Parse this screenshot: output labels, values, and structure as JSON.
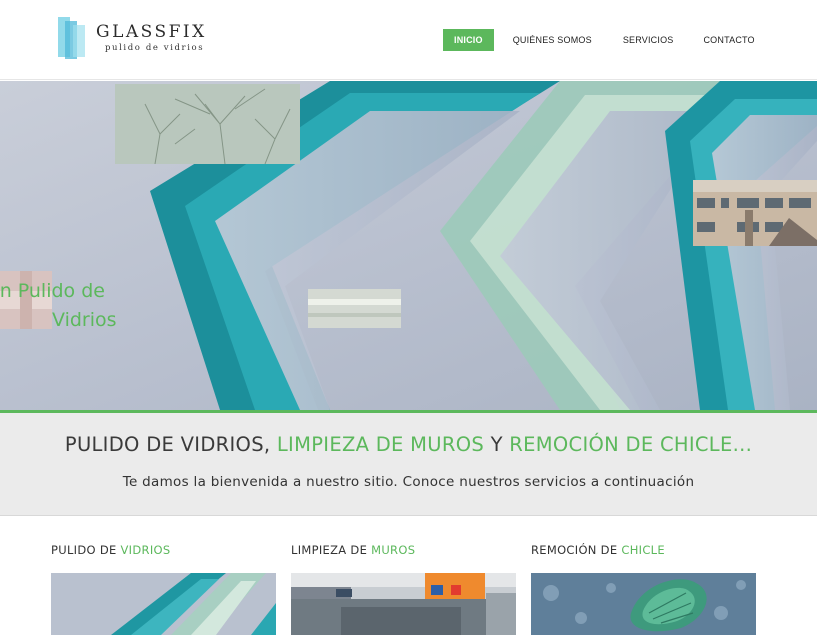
{
  "header": {
    "logo": {
      "name": "GLASSFIX",
      "tagline": "pulido de vidrios"
    },
    "nav": [
      {
        "label": "INICIO",
        "active": true
      },
      {
        "label": "QUIÉNES SOMOS",
        "active": false
      },
      {
        "label": "SERVICIOS",
        "active": false
      },
      {
        "label": "CONTACTO",
        "active": false
      }
    ]
  },
  "hero": {
    "caption_line1": "en Pulido de",
    "caption_line2": "Vidrios"
  },
  "welcome": {
    "title_part1": "PULIDO DE VIDRIOS,",
    "title_part2": "LIMPIEZA DE MUROS",
    "title_part3": "Y",
    "title_part4": "REMOCIÓN DE CHICLE...",
    "subtitle": "Te damos la bienvenida a nuestro sitio. Conoce nuestros servicios a continuación"
  },
  "services": [
    {
      "title_dark": "PULIDO DE",
      "title_green": "VIDRIOS"
    },
    {
      "title_dark": "LIMPIEZA DE",
      "title_green": "MUROS"
    },
    {
      "title_dark": "REMOCIÓN DE",
      "title_green": "CHICLE"
    }
  ],
  "colors": {
    "accent": "#5cb85c",
    "text_dark": "#333333",
    "band_bg": "#ebebeb",
    "glass_teal": "#1f9aa4"
  }
}
